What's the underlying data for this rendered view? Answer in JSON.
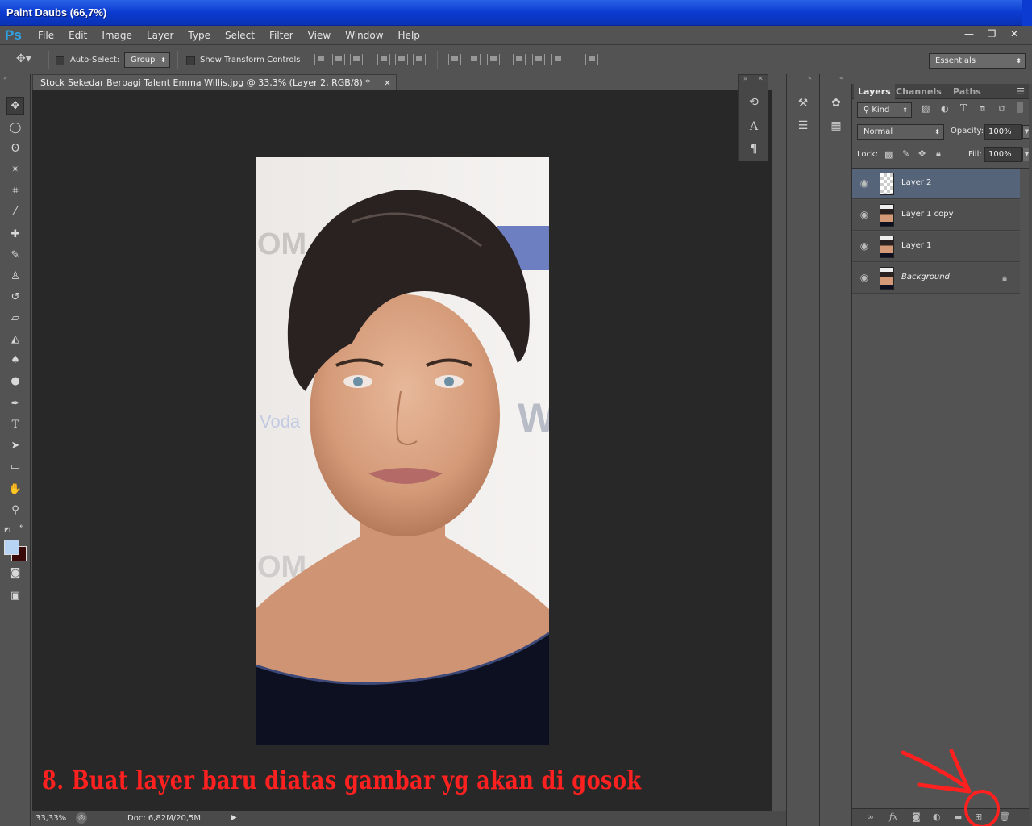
{
  "window": {
    "title": "Paint Daubs (66,7%)"
  },
  "app": {
    "logo": "Ps"
  },
  "menu": [
    "File",
    "Edit",
    "Image",
    "Layer",
    "Type",
    "Select",
    "Filter",
    "View",
    "Window",
    "Help"
  ],
  "window_controls": {
    "minimize": "—",
    "restore": "❐",
    "close": "✕"
  },
  "options": {
    "auto_select_label": "Auto-Select:",
    "auto_select_value": "Group",
    "transform_label": "Show Transform Controls",
    "workspace": "Essentials"
  },
  "document": {
    "tab_title": "Stock Sekedar Berbagi Talent Emma Willis.jpg @ 33,3% (Layer 2, RGB/8) *",
    "tab_close": "×",
    "caption": "8. Buat layer baru diatas gambar yg akan di gosok",
    "zoom": "33,33%",
    "doc_size": "Doc: 6,82M/20,5M"
  },
  "layers_panel": {
    "tabs": [
      "Layers",
      "Channels",
      "Paths"
    ],
    "kind": "Kind",
    "blend_mode": "Normal",
    "opacity_label": "Opacity:",
    "opacity": "100%",
    "lock_label": "Lock:",
    "fill_label": "Fill:",
    "fill": "100%",
    "layers": [
      {
        "name": "Layer 2",
        "selected": true
      },
      {
        "name": "Layer 1 copy",
        "selected": false
      },
      {
        "name": "Layer 1",
        "selected": false
      },
      {
        "name": "Background",
        "selected": false
      }
    ]
  },
  "colors": {
    "foreground": "#b8d4f5",
    "background": "#3a0a0a",
    "accent": "#ff2020"
  }
}
